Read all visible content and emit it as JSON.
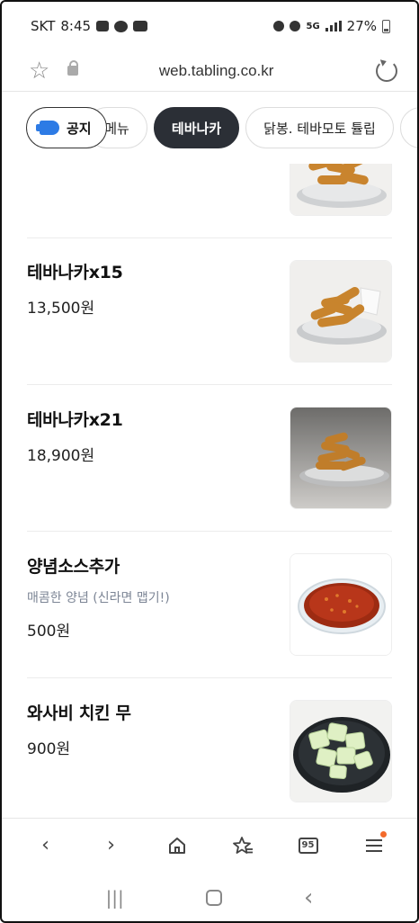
{
  "status": {
    "carrier": "SKT",
    "time": "8:45",
    "network": "5G",
    "battery": "27%"
  },
  "browser": {
    "url": "web.tabling.co.kr"
  },
  "tabs": {
    "notice_label": "공지",
    "items": [
      {
        "label": "메뉴"
      },
      {
        "label": "테바나카",
        "active": true
      },
      {
        "label": "닭봉. 테바모토 튤립"
      }
    ]
  },
  "menu_items": [
    {
      "name": "테바나카x15",
      "price": "13,500원"
    },
    {
      "name": "테바나카x21",
      "price": "18,900원"
    },
    {
      "name": "양념소스추가",
      "description": "매콤한 양념 (신라면 맵기!)",
      "price": "500원"
    },
    {
      "name": "와사비 치킨 무",
      "price": "900원"
    }
  ],
  "bottom_nav": {
    "tabs_count": "95"
  },
  "colors": {
    "active_chip": "#2b2f36",
    "accent_blue": "#2d7be5",
    "notification_dot": "#f36a2b"
  }
}
